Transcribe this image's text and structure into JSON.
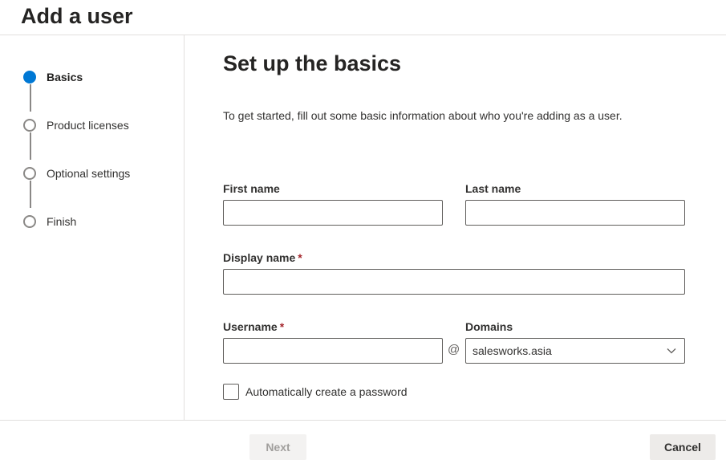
{
  "page": {
    "title": "Add a user"
  },
  "steps": [
    {
      "label": "Basics",
      "state": "current"
    },
    {
      "label": "Product licenses",
      "state": "upcoming"
    },
    {
      "label": "Optional settings",
      "state": "upcoming"
    },
    {
      "label": "Finish",
      "state": "upcoming"
    }
  ],
  "form": {
    "title": "Set up the basics",
    "intro": "To get started, fill out some basic information about who you're adding as a user.",
    "first_name": {
      "label": "First name",
      "value": ""
    },
    "last_name": {
      "label": "Last name",
      "value": ""
    },
    "display_name": {
      "label": "Display name",
      "required_mark": "*",
      "value": ""
    },
    "username": {
      "label": "Username",
      "required_mark": "*",
      "value": ""
    },
    "at_sign": "@",
    "domains": {
      "label": "Domains",
      "selected": "salesworks.asia"
    },
    "auto_password": {
      "label": "Automatically create a password",
      "checked": false
    }
  },
  "footer": {
    "next_label": "Next",
    "cancel_label": "Cancel"
  },
  "colors": {
    "accent": "#0078d4",
    "required": "#a4262c"
  },
  "icons": {
    "dropdown": "chevron-down-icon"
  }
}
